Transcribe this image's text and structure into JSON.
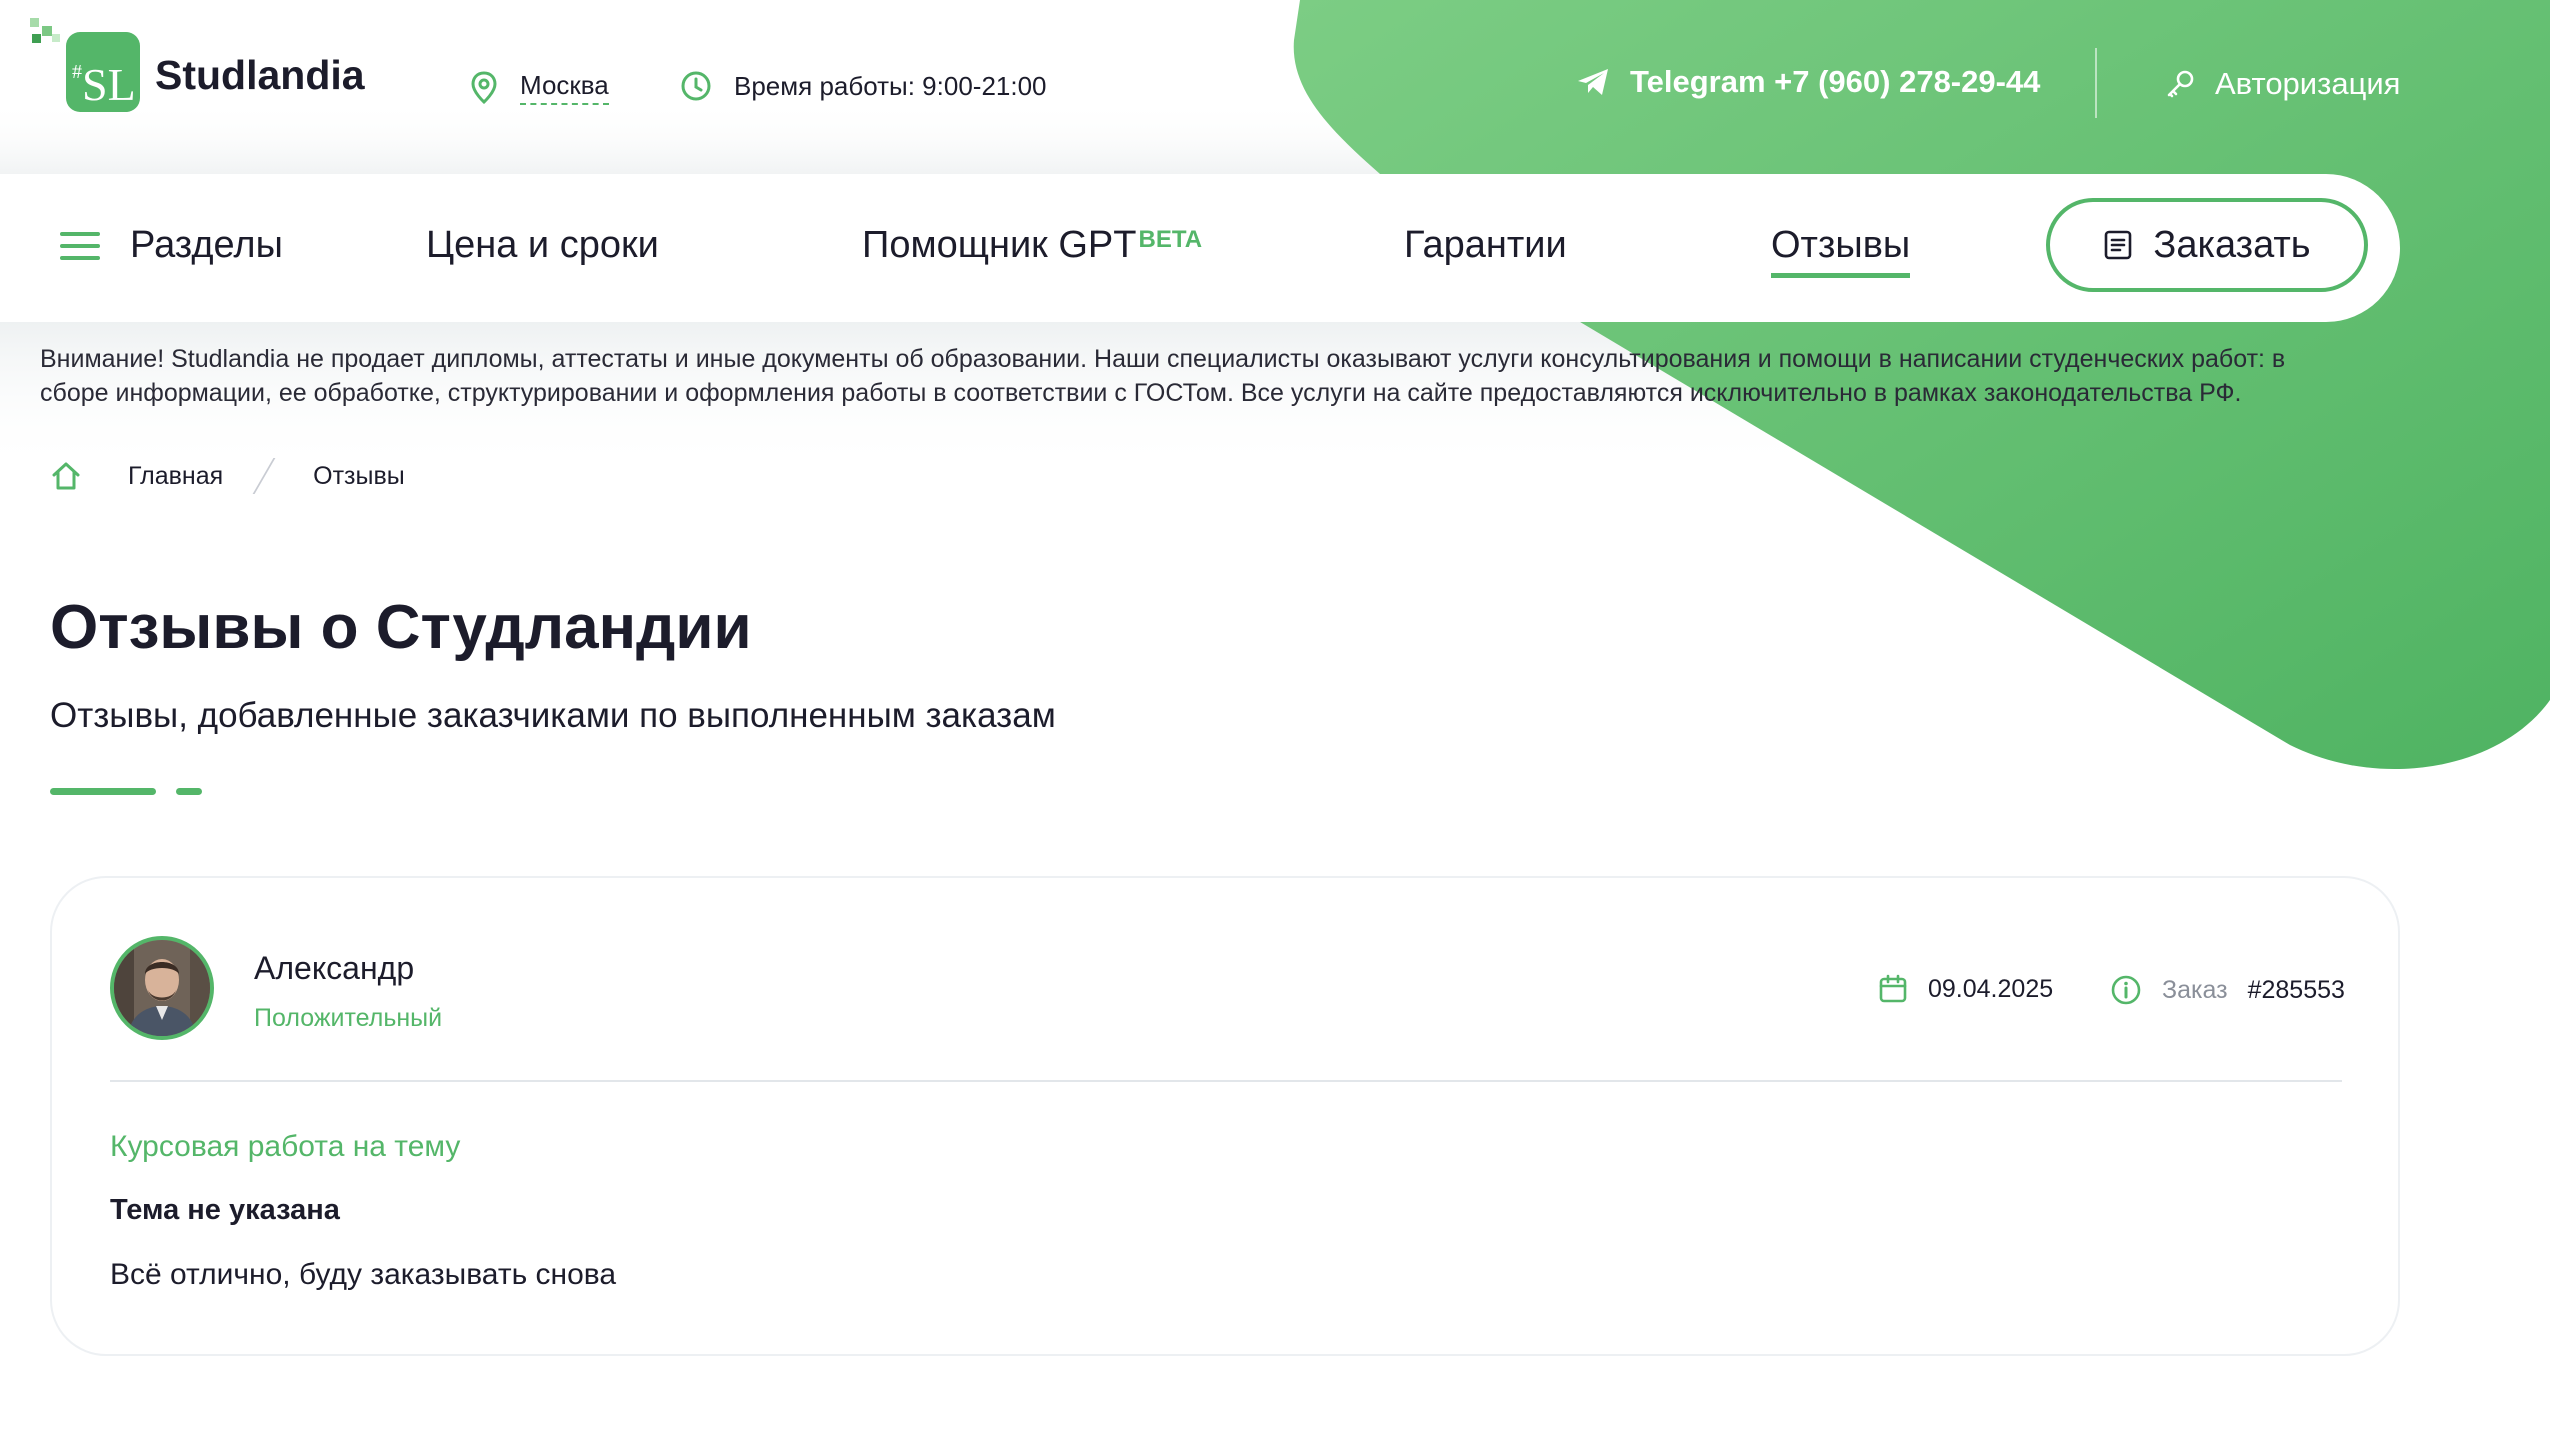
{
  "brand": {
    "name": "Studlandia",
    "logo_letters": "SL",
    "logo_hash": "#",
    "accent_color": "#54b669"
  },
  "header": {
    "city": "Москва",
    "hours": "Время работы: 9:00-21:00",
    "telegram": "Telegram +7 (960) 278-29-44",
    "auth": "Авторизация"
  },
  "nav": {
    "sections": "Разделы",
    "price": "Цена и сроки",
    "gpt": "Помощник GPT",
    "gpt_badge": "BETA",
    "guarantees": "Гарантии",
    "reviews": "Отзывы",
    "order_button": "Заказать"
  },
  "notice": "Внимание! Studlandia не продает дипломы, аттестаты и иные документы об образовании. Наши специалисты оказывают услуги консультирования и помощи в написании студенческих работ: в сборе информации, ее обработке, структурировании и оформления работы в соответствии с ГОСТом. Все услуги на сайте предоставляются исключительно в рамках законодательства РФ.",
  "breadcrumb": {
    "home": "Главная",
    "current": "Отзывы"
  },
  "page": {
    "title": "Отзывы о Студландии",
    "subtitle": "Отзывы, добавленные заказчиками по выполненным заказам"
  },
  "review": {
    "author": "Александр",
    "sentiment": "Положительный",
    "date": "09.04.2025",
    "order_label": "Заказ",
    "order_number": "#285553",
    "work_type": "Курсовая работа на тему",
    "topic": "Тема не указана",
    "text": "Всё отлично, буду заказывать снова"
  }
}
